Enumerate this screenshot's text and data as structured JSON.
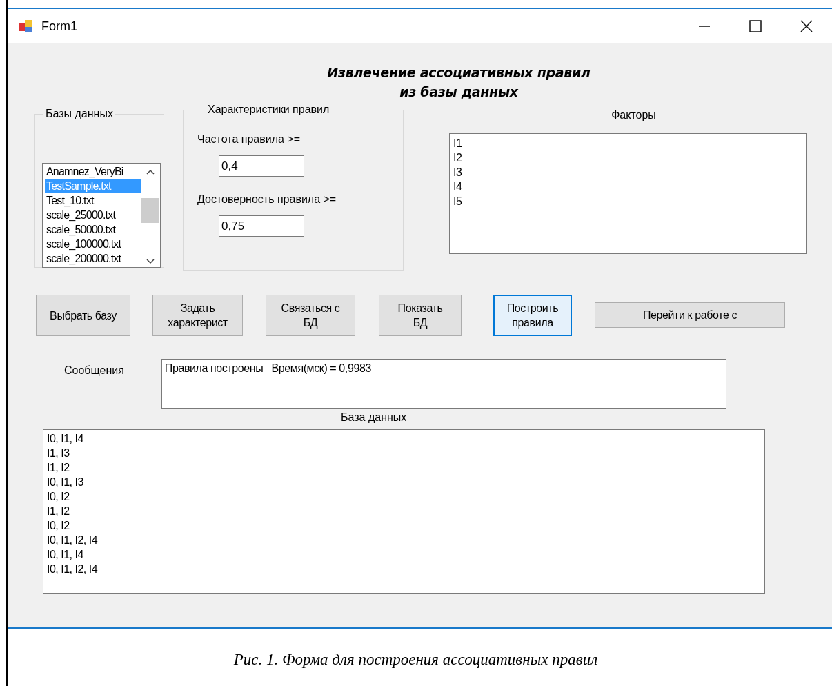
{
  "window": {
    "title": "Form1"
  },
  "heading": [
    "Извлечение ассоциативных правил",
    "из базы данных"
  ],
  "databases": {
    "label": "Базы данных",
    "items": [
      {
        "name": "Anamnez_VeryBi",
        "selected": false
      },
      {
        "name": "TestSample.txt",
        "selected": true
      },
      {
        "name": "Test_10.txt",
        "selected": false
      },
      {
        "name": "scale_25000.txt",
        "selected": false
      },
      {
        "name": "scale_50000.txt",
        "selected": false
      },
      {
        "name": "scale_100000.txt",
        "selected": false
      },
      {
        "name": "scale_200000.txt",
        "selected": false
      }
    ]
  },
  "rule_settings": {
    "label": "Характеристики правил",
    "fields": [
      {
        "label": "Частота правила >=",
        "value": "0,4"
      },
      {
        "label": "Достоверность правила >=",
        "value": "0,75"
      }
    ]
  },
  "factors": {
    "label": "Факторы",
    "items": [
      "I1",
      "I2",
      "I3",
      "I4",
      "I5"
    ]
  },
  "buttons": [
    {
      "lines": [
        "Выбрать базу"
      ],
      "focused": false
    },
    {
      "lines": [
        "Задать",
        "характерист"
      ],
      "focused": false
    },
    {
      "lines": [
        "Связаться с",
        "БД"
      ],
      "focused": false
    },
    {
      "lines": [
        "Показать",
        "БД"
      ],
      "focused": false
    },
    {
      "lines": [
        "Построить",
        "правила"
      ],
      "focused": true
    },
    {
      "lines": [
        "Перейти к работе с"
      ],
      "focused": false
    }
  ],
  "messages": {
    "label": "Сообщения",
    "text": "Правила построены   Время(мск) = 0,9983"
  },
  "database": {
    "label": "База данных",
    "rows": [
      "I0, I1, I4",
      "I1, I3",
      "I1, I2",
      "I0, I1, I3",
      "I0, I2",
      "I1, I2",
      "I0, I2",
      "I0, I1, I2, I4",
      "I0, I1, I4",
      "I0, I1, I2, I4"
    ]
  },
  "caption": "Рис. 1. Форма для построения ассоциативных правил"
}
